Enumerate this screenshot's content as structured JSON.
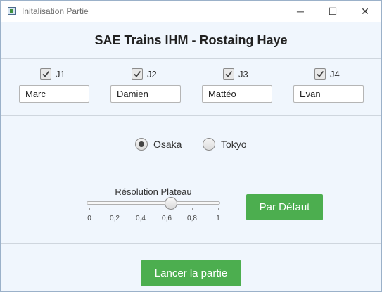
{
  "window": {
    "title": "Initalisation Partie",
    "controls": {
      "minimize": "─",
      "maximize": "☐",
      "close": "✕"
    }
  },
  "header": {
    "title": "SAE Trains IHM - Rostaing Haye"
  },
  "players": [
    {
      "label": "J1",
      "checked": true,
      "name": "Marc"
    },
    {
      "label": "J2",
      "checked": true,
      "name": "Damien"
    },
    {
      "label": "J3",
      "checked": true,
      "name": "Mattéo"
    },
    {
      "label": "J4",
      "checked": true,
      "name": "Evan"
    }
  ],
  "maps": {
    "options": [
      {
        "label": "Osaka",
        "selected": true
      },
      {
        "label": "Tokyo",
        "selected": false
      }
    ]
  },
  "resolution": {
    "label": "Résolution Plateau",
    "value": 0.63,
    "min": 0,
    "max": 1,
    "tick_labels": [
      "0",
      "0,2",
      "0,4",
      "0,6",
      "0,8",
      "1"
    ],
    "default_button": "Par Défaut"
  },
  "launch_button": "Lancer la partie",
  "colors": {
    "accent": "#4cae4f",
    "background": "#f0f6fd"
  }
}
